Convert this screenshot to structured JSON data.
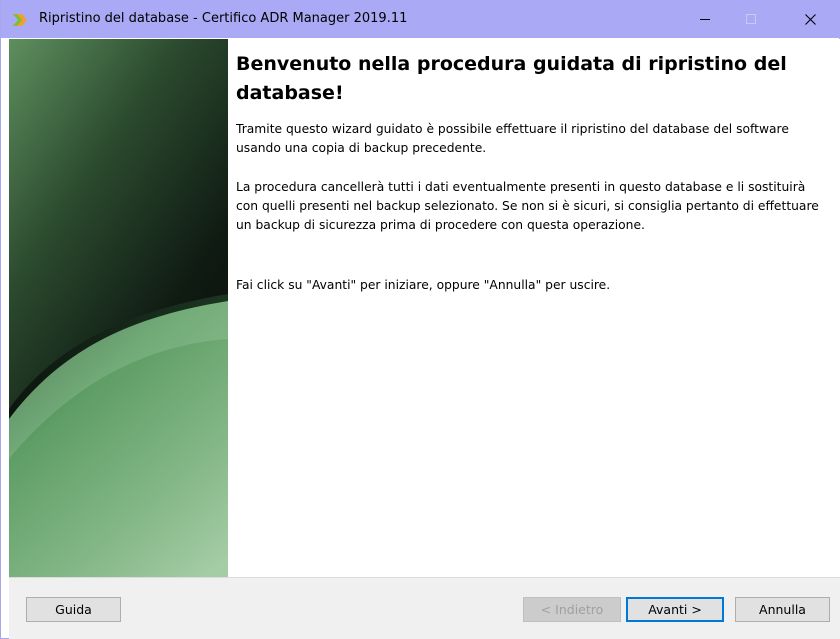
{
  "window": {
    "title": "Ripristino del database - Certifico ADR Manager 2019.11"
  },
  "content": {
    "heading": "Benvenuto nella procedura guidata di ripristino del database!",
    "paragraph_1": "Tramite questo wizard guidato è possibile effettuare il ripristino del database del software usando una copia di backup precedente.",
    "paragraph_2": "La procedura cancellerà tutti i dati eventualmente presenti in questo database e li sostituirà con quelli presenti nel backup selezionato. Se non si è sicuri, si consiglia pertanto di effettuare un backup di sicurezza prima di procedere con questa operazione.",
    "paragraph_3": "Fai click su \"Avanti\" per iniziare, oppure \"Annulla\" per uscire."
  },
  "buttons": {
    "help": "Guida",
    "back": "< Indietro",
    "next": "Avanti >",
    "cancel": "Annulla"
  },
  "colors": {
    "titlebar": "#a9a9f5",
    "footer": "#f0f0f0",
    "focus_border": "#0078d7"
  },
  "icons": {
    "app": "app-logo-icon",
    "minimize": "minimize-icon",
    "maximize": "maximize-icon",
    "close": "close-icon"
  }
}
